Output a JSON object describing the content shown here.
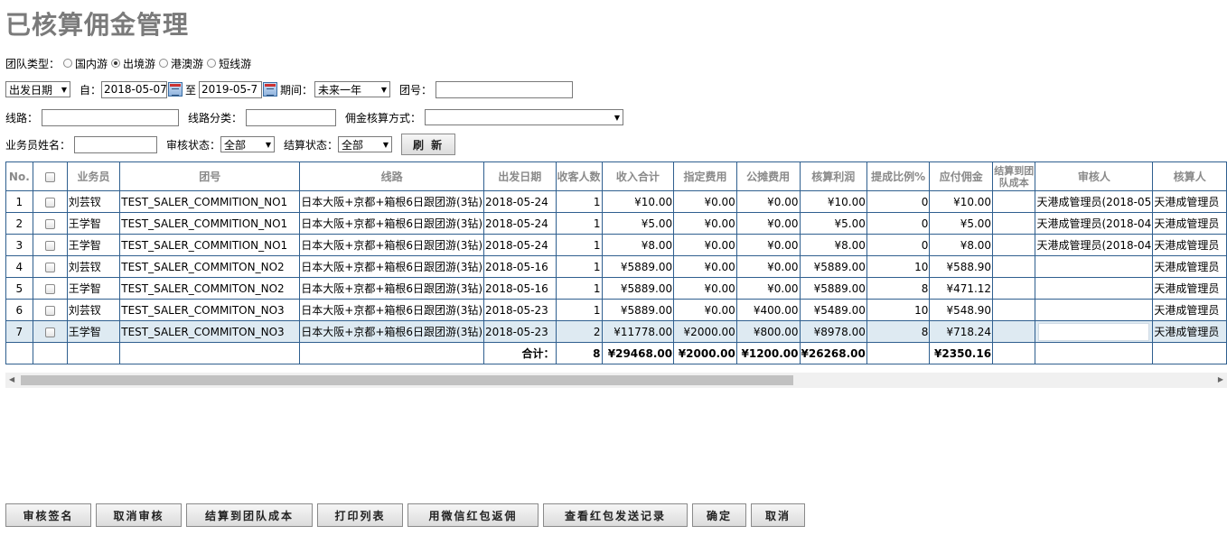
{
  "page": {
    "title": "已核算佣金管理"
  },
  "filters": {
    "team_type_label": "团队类型：",
    "team_types": [
      {
        "label": "国内游",
        "checked": false
      },
      {
        "label": "出境游",
        "checked": true
      },
      {
        "label": "港澳游",
        "checked": false
      },
      {
        "label": "短线游",
        "checked": false
      }
    ],
    "date_type": "出发日期",
    "from_label": "自：",
    "from_date": "2018-05-07",
    "to_label": "至",
    "to_date": "2019-05-7",
    "period_label": "期间：",
    "period_value": "未来一年",
    "team_no_label": "团号：",
    "team_no_value": "",
    "route_label": "线路：",
    "route_value": "",
    "route_category_label": "线路分类：",
    "route_category_value": "",
    "commission_method_label": "佣金核算方式：",
    "commission_method_value": "",
    "salesman_label": "业务员姓名：",
    "salesman_value": "",
    "audit_status_label": "审核状态：",
    "audit_status_value": "全部",
    "settle_status_label": "结算状态：",
    "settle_status_value": "全部",
    "refresh_label": "刷 新"
  },
  "table": {
    "headers": {
      "no": "No.",
      "salesman": "业务员",
      "team_no": "团号",
      "route": "线路",
      "depart_date": "出发日期",
      "guests": "收客人数",
      "income": "收入合计",
      "designated_fee": "指定费用",
      "shared_fee": "公摊费用",
      "profit": "核算利润",
      "rate": "提成比例%",
      "commission": "应付佣金",
      "settled_to_cost": "结算到团队成本",
      "auditor": "审核人",
      "accountant": "核算人"
    },
    "rows": [
      {
        "no": "1",
        "salesman": "刘芸钗",
        "team_no": "TEST_SALER_COMMITION_NO1",
        "route": "日本大阪+京都+箱根6日跟团游(3钻)",
        "depart_date": "2018-05-24",
        "guests": "1",
        "income": "¥10.00",
        "designated_fee": "¥0.00",
        "shared_fee": "¥0.00",
        "profit": "¥10.00",
        "rate": "0",
        "commission": "¥10.00",
        "settled_to_cost": "",
        "auditor": "天港成管理员(2018-05",
        "accountant": "天港成管理员"
      },
      {
        "no": "2",
        "salesman": "王学智",
        "team_no": "TEST_SALER_COMMITION_NO1",
        "route": "日本大阪+京都+箱根6日跟团游(3钻)",
        "depart_date": "2018-05-24",
        "guests": "1",
        "income": "¥5.00",
        "designated_fee": "¥0.00",
        "shared_fee": "¥0.00",
        "profit": "¥5.00",
        "rate": "0",
        "commission": "¥5.00",
        "settled_to_cost": "",
        "auditor": "天港成管理员(2018-04",
        "accountant": "天港成管理员"
      },
      {
        "no": "3",
        "salesman": "王学智",
        "team_no": "TEST_SALER_COMMITION_NO1",
        "route": "日本大阪+京都+箱根6日跟团游(3钻)",
        "depart_date": "2018-05-24",
        "guests": "1",
        "income": "¥8.00",
        "designated_fee": "¥0.00",
        "shared_fee": "¥0.00",
        "profit": "¥8.00",
        "rate": "0",
        "commission": "¥8.00",
        "settled_to_cost": "",
        "auditor": "天港成管理员(2018-04",
        "accountant": "天港成管理员"
      },
      {
        "no": "4",
        "salesman": "刘芸钗",
        "team_no": "TEST_SALER_COMMITON_NO2",
        "route": "日本大阪+京都+箱根6日跟团游(3钻)",
        "depart_date": "2018-05-16",
        "guests": "1",
        "income": "¥5889.00",
        "designated_fee": "¥0.00",
        "shared_fee": "¥0.00",
        "profit": "¥5889.00",
        "rate": "10",
        "commission": "¥588.90",
        "settled_to_cost": "",
        "auditor": "",
        "accountant": "天港成管理员"
      },
      {
        "no": "5",
        "salesman": "王学智",
        "team_no": "TEST_SALER_COMMITON_NO2",
        "route": "日本大阪+京都+箱根6日跟团游(3钻)",
        "depart_date": "2018-05-16",
        "guests": "1",
        "income": "¥5889.00",
        "designated_fee": "¥0.00",
        "shared_fee": "¥0.00",
        "profit": "¥5889.00",
        "rate": "8",
        "commission": "¥471.12",
        "settled_to_cost": "",
        "auditor": "",
        "accountant": "天港成管理员"
      },
      {
        "no": "6",
        "salesman": "刘芸钗",
        "team_no": "TEST_SALER_COMMITON_NO3",
        "route": "日本大阪+京都+箱根6日跟团游(3钻)",
        "depart_date": "2018-05-23",
        "guests": "1",
        "income": "¥5889.00",
        "designated_fee": "¥0.00",
        "shared_fee": "¥400.00",
        "profit": "¥5489.00",
        "rate": "10",
        "commission": "¥548.90",
        "settled_to_cost": "",
        "auditor": "",
        "accountant": "天港成管理员"
      },
      {
        "no": "7",
        "salesman": "王学智",
        "team_no": "TEST_SALER_COMMITON_NO3",
        "route": "日本大阪+京都+箱根6日跟团游(3钻)",
        "depart_date": "2018-05-23",
        "guests": "2",
        "income": "¥11778.00",
        "designated_fee": "¥2000.00",
        "shared_fee": "¥800.00",
        "profit": "¥8978.00",
        "rate": "8",
        "commission": "¥718.24",
        "settled_to_cost": "",
        "auditor": "",
        "accountant": "天港成管理员"
      }
    ],
    "total": {
      "label": "合计：",
      "guests": "8",
      "income": "¥29468.00",
      "designated_fee": "¥2000.00",
      "shared_fee": "¥1200.00",
      "profit": "¥26268.00",
      "commission": "¥2350.16"
    }
  },
  "actions": {
    "audit_sign": "审核签名",
    "cancel_audit": "取消审核",
    "settle_to_cost": "结算到团队成本",
    "print_list": "打印列表",
    "wechat_redpack": "用微信红包返佣",
    "view_redpack_log": "查看红包发送记录",
    "confirm": "确定",
    "cancel": "取消"
  }
}
